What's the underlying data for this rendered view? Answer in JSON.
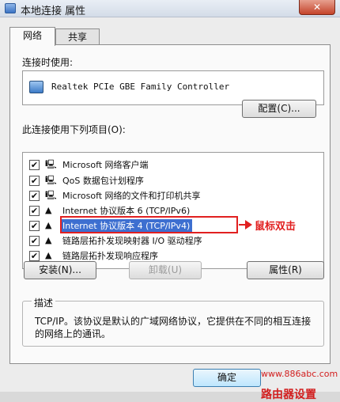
{
  "window": {
    "title": "本地连接 属性",
    "close_label": "✕"
  },
  "tabs": [
    {
      "label": "网络",
      "active": true
    },
    {
      "label": "共享",
      "active": false
    }
  ],
  "connect_using": {
    "label": "连接时使用:",
    "adapter": "Realtek PCIe GBE Family Controller",
    "icon": "network-adapter-icon"
  },
  "configure_button": "配置(C)...",
  "items_label": "此连接使用下列项目(O):",
  "items": [
    {
      "label": "Microsoft 网络客户端",
      "checked": true,
      "icon": "network-client-icon",
      "selected": false
    },
    {
      "label": "QoS 数据包计划程序",
      "checked": true,
      "icon": "qos-icon",
      "selected": false
    },
    {
      "label": "Microsoft 网络的文件和打印机共享",
      "checked": true,
      "icon": "file-print-share-icon",
      "selected": false
    },
    {
      "label": "Internet 协议版本 6 (TCP/IPv6)",
      "checked": true,
      "icon": "protocol-icon",
      "selected": false
    },
    {
      "label": "Internet 协议版本 4 (TCP/IPv4)",
      "checked": true,
      "icon": "protocol-icon",
      "selected": true
    },
    {
      "label": "链路层拓扑发现映射器 I/O 驱动程序",
      "checked": true,
      "icon": "protocol-icon",
      "selected": false
    },
    {
      "label": "链路层拓扑发现响应程序",
      "checked": true,
      "icon": "protocol-icon",
      "selected": false
    }
  ],
  "annotation": {
    "text": "鼠标双击",
    "color": "#e12020"
  },
  "buttons": {
    "install": "安装(N)...",
    "uninstall": "卸载(U)",
    "properties": "属性(R)",
    "ok": "确定"
  },
  "description": {
    "title": "描述",
    "text": "TCP/IP。该协议是默认的广域网络协议，它提供在不同的相互连接的网络上的通讯。"
  },
  "watermark": {
    "url": "www.886abc.com",
    "brand": "路由器设置"
  }
}
